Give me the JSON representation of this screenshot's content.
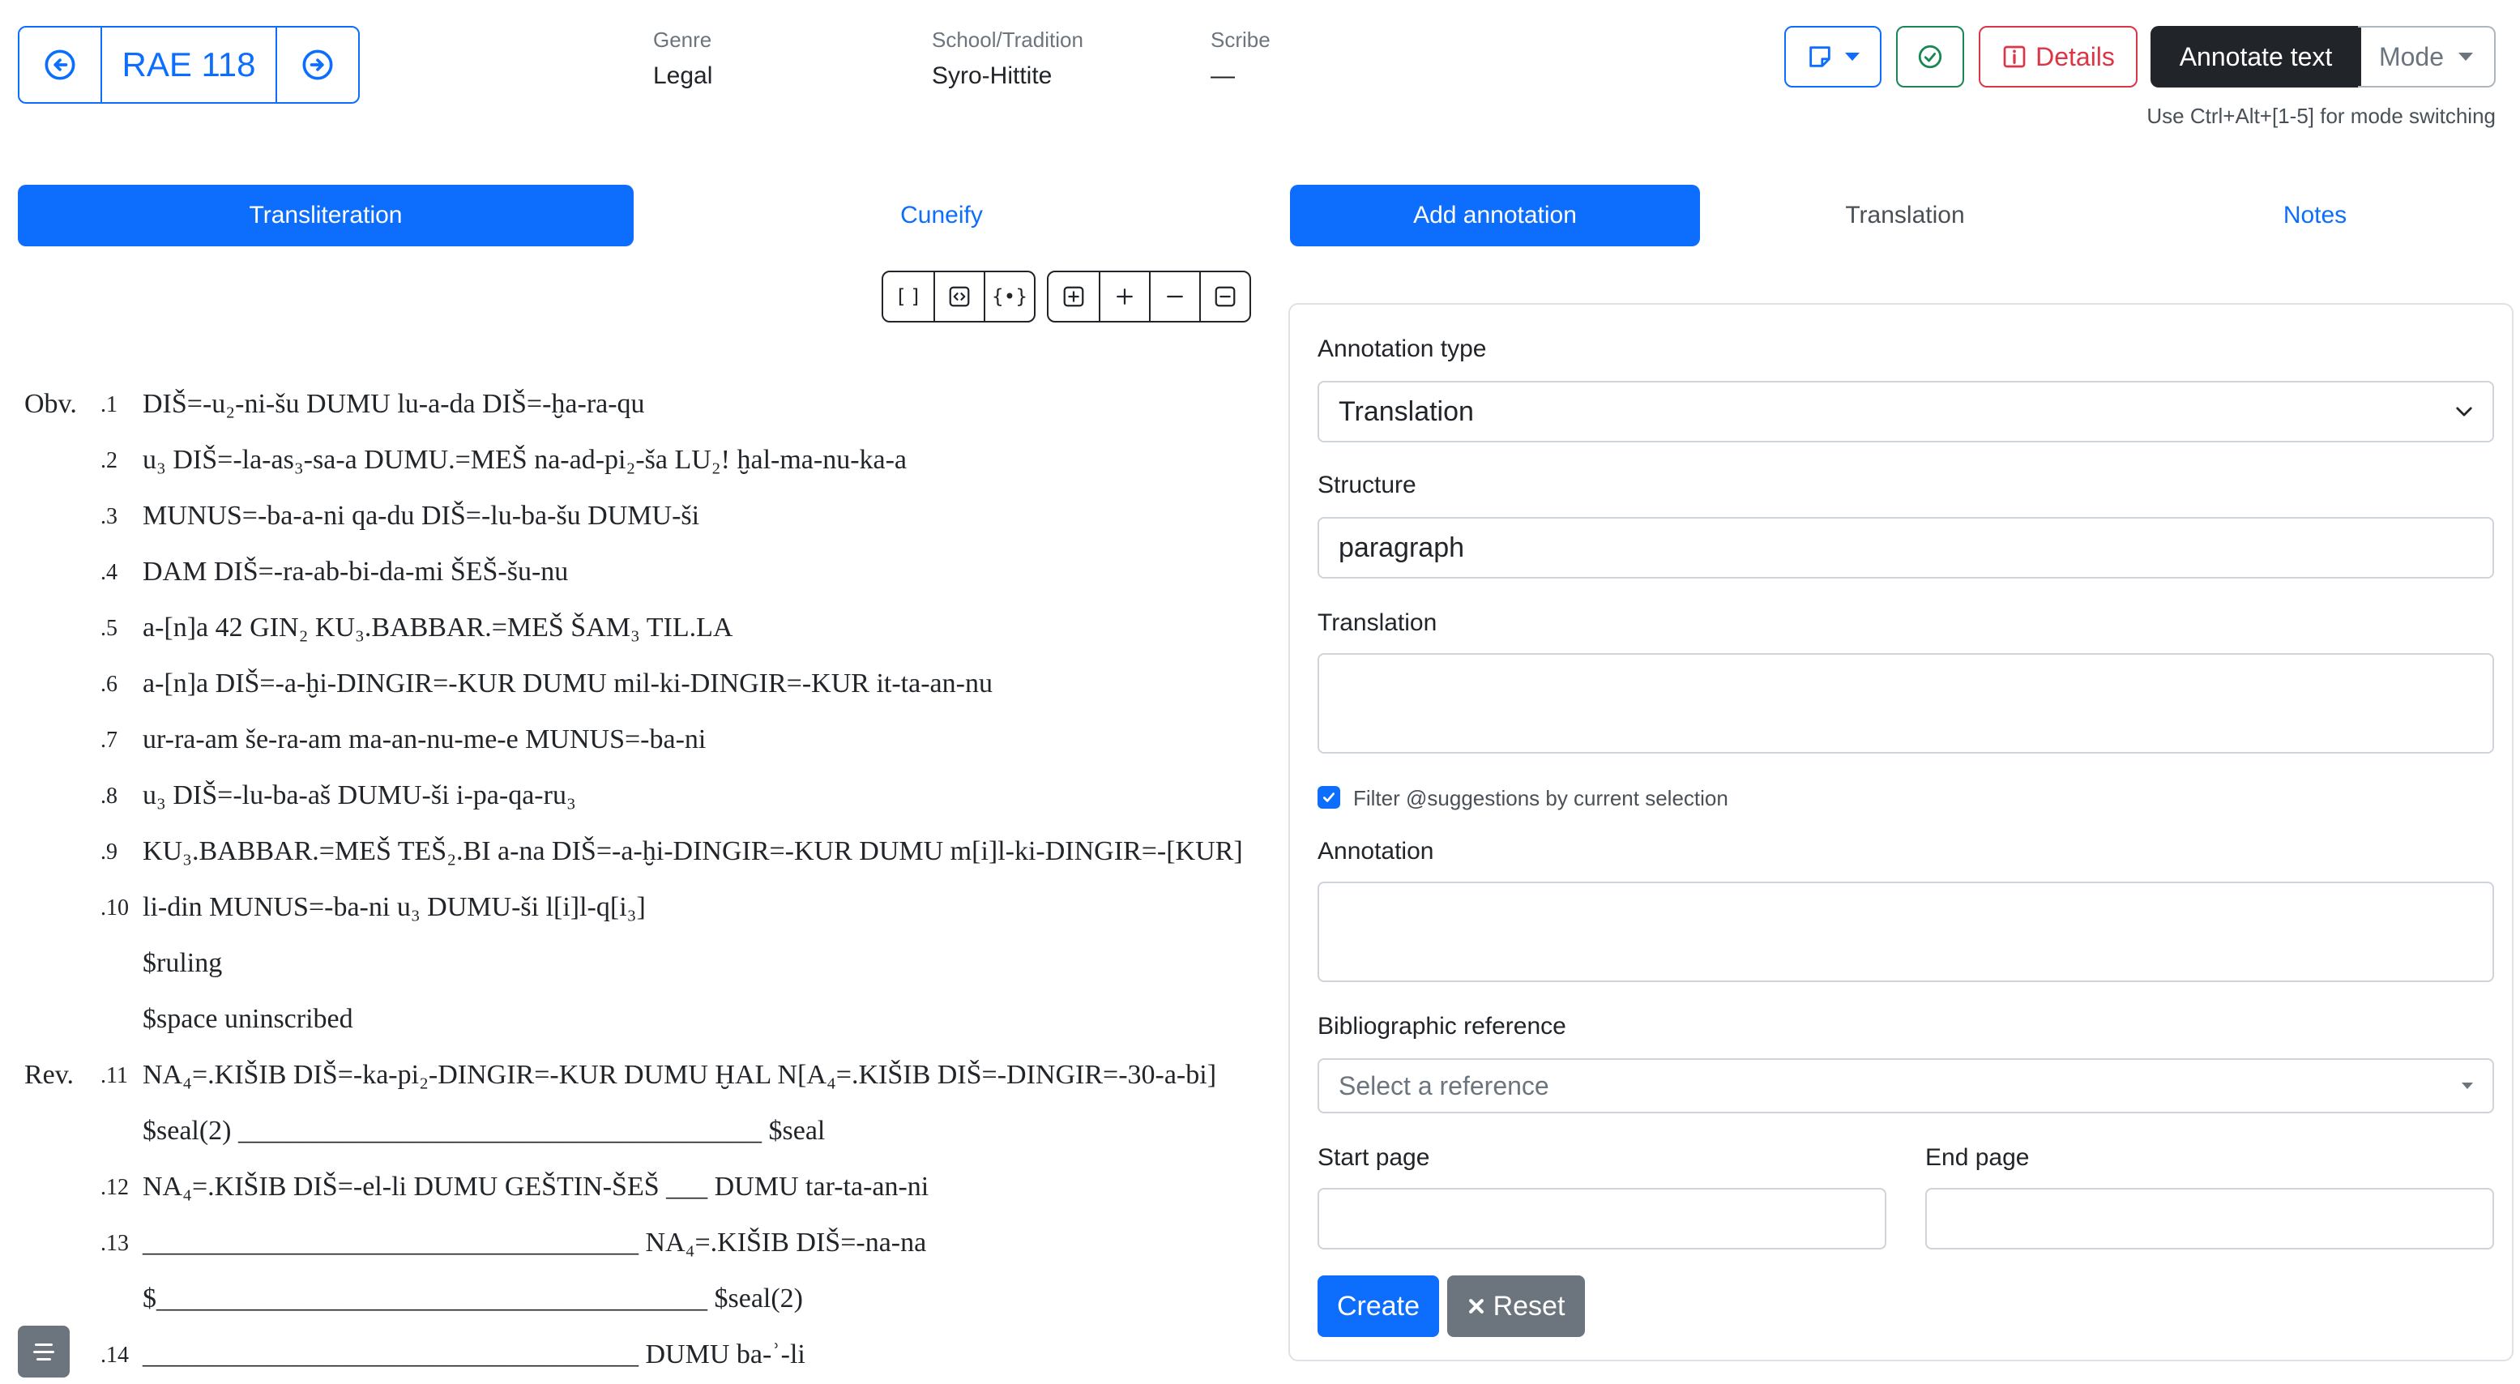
{
  "header": {
    "text_id": "RAE 118",
    "genre_label": "Genre",
    "genre_value": "Legal",
    "school_label": "School/Tradition",
    "school_value": "Syro-Hittite",
    "scribe_label": "Scribe",
    "scribe_value": "—"
  },
  "toolbar": {
    "details_label": "Details",
    "annotate_label": "Annotate text",
    "mode_label": "Mode",
    "hint": "Use Ctrl+Alt+[1-5] for mode switching"
  },
  "left_tabs": [
    "Transliteration",
    "Cuneify"
  ],
  "right_tabs": [
    "Add annotation",
    "Translation",
    "Notes"
  ],
  "editor_buttons": [
    "[ ]",
    "{•}"
  ],
  "text_lines": [
    {
      "surface": "Obv.",
      "num": ".1",
      "text": "DIŠ=-u₂-ni-šu DUMU lu-a-da DIŠ=-ḫa-ra-qu"
    },
    {
      "surface": "",
      "num": ".2",
      "text": "u₃ DIŠ=-la-as₃-sa-a DUMU.=MEŠ na-ad-pi₂-ša LU₂! ḫal-ma-nu-ka-a"
    },
    {
      "surface": "",
      "num": ".3",
      "text": "MUNUS=-ba-a-ni qa-du DIŠ=-lu-ba-šu DUMU-ši"
    },
    {
      "surface": "",
      "num": ".4",
      "text": "DAM DIŠ=-ra-ab-bi-da-mi ŠEŠ-šu-nu"
    },
    {
      "surface": "",
      "num": ".5",
      "text": "a-[n]a 42 GIN₂ KU₃.BABBAR.=MEŠ ŠAM₃ TIL.LA"
    },
    {
      "surface": "",
      "num": ".6",
      "text": "a-[n]a DIŠ=-a-ḫi-DINGIR=-KUR DUMU mil-ki-DINGIR=-KUR it-ta-an-nu"
    },
    {
      "surface": "",
      "num": ".7",
      "text": "ur-ra-am še-ra-am ma-an-nu-me-e MUNUS=-ba-ni"
    },
    {
      "surface": "",
      "num": ".8",
      "text": "u₃ DIŠ=-lu-ba-aš DUMU-ši i-pa-qa-ru₃"
    },
    {
      "surface": "",
      "num": ".9",
      "text": "KU₃.BABBAR.=MEŠ TEŠ₂.BI a-na DIŠ=-a-ḫi-DINGIR=-KUR DUMU m[i]l-ki-DINGIR=-[KUR]"
    },
    {
      "surface": "",
      "num": ".10",
      "text": "li-din MUNUS=-ba-ni u₃ DUMU-ši l[i]l-q[i₃]"
    },
    {
      "surface": "",
      "num": "",
      "text": "$ruling"
    },
    {
      "surface": "",
      "num": "",
      "text": "$space uninscribed"
    },
    {
      "surface": "Rev.",
      "num": ".11",
      "text": "NA₄=.KIŠIB DIŠ=-ka-pi₂-DINGIR=-KUR DUMU ḪAL N[A₄=.KIŠIB DIŠ=-DINGIR=-30-a-bi]"
    },
    {
      "surface": "",
      "num": "",
      "text": "$seal(2) ______________________________________ $seal"
    },
    {
      "surface": "",
      "num": ".12",
      "text": "NA₄=.KIŠIB DIŠ=-el-li DUMU GEŠTIN-ŠEŠ ___ DUMU tar-ta-an-ni"
    },
    {
      "surface": "",
      "num": ".13",
      "text": "____________________________________ NA₄=.KIŠIB DIŠ=-na-na"
    },
    {
      "surface": "",
      "num": "",
      "text": "$________________________________________ $seal(2)"
    },
    {
      "surface": "",
      "num": ".14",
      "text": "____________________________________ DUMU ba-ʾ-li"
    }
  ],
  "form": {
    "annotation_type_label": "Annotation type",
    "annotation_type_value": "Translation",
    "structure_label": "Structure",
    "structure_value": "paragraph",
    "translation_label": "Translation",
    "translation_value": "",
    "filter_label": "Filter @suggestions by current selection",
    "filter_checked": true,
    "annotation_label": "Annotation",
    "annotation_value": "",
    "biblio_label": "Bibliographic reference",
    "biblio_placeholder": "Select a reference",
    "start_page_label": "Start page",
    "start_page_value": "",
    "end_page_label": "End page",
    "end_page_value": "",
    "create_label": "Create",
    "reset_label": "Reset"
  },
  "icons": {
    "prev": "arrow-left-circle-icon",
    "next": "arrow-right-circle-icon",
    "note": "sticky-note-icon",
    "check": "check-circle-icon",
    "info": "info-square-icon",
    "reset": "times-icon",
    "sidebar": "text-lines-icon"
  },
  "colors": {
    "primary": "#0d6efd",
    "success": "#198754",
    "danger": "#dc3545",
    "dark": "#212529",
    "secondary": "#6c757d"
  }
}
